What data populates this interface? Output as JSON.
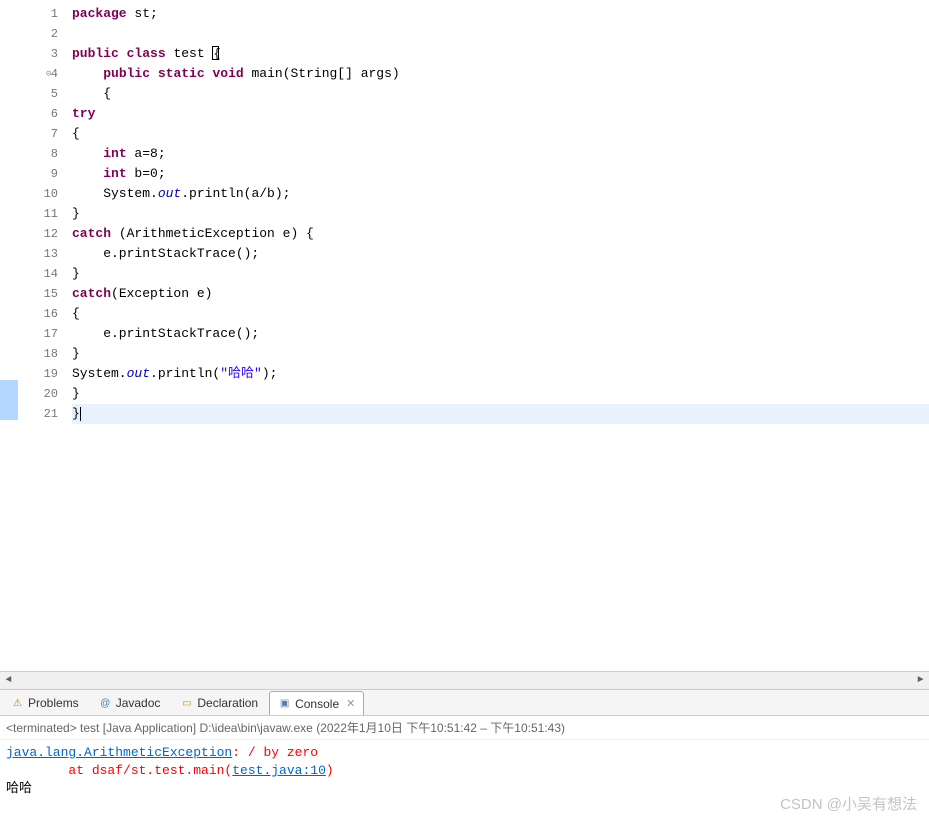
{
  "editor": {
    "lines": [
      {
        "n": "1",
        "strip": "",
        "segs": [
          {
            "t": "kw",
            "v": "package"
          },
          {
            "t": "plain",
            "v": " st;"
          }
        ]
      },
      {
        "n": "2",
        "strip": "",
        "segs": []
      },
      {
        "n": "3",
        "strip": "",
        "segs": [
          {
            "t": "kw",
            "v": "public"
          },
          {
            "t": "plain",
            "v": " "
          },
          {
            "t": "kw",
            "v": "class"
          },
          {
            "t": "plain",
            "v": " test "
          },
          {
            "t": "box",
            "v": "{"
          }
        ]
      },
      {
        "n": "4",
        "marker": "⊝",
        "strip": "",
        "segs": [
          {
            "t": "plain",
            "v": "    "
          },
          {
            "t": "kw",
            "v": "public"
          },
          {
            "t": "plain",
            "v": " "
          },
          {
            "t": "kw",
            "v": "static"
          },
          {
            "t": "plain",
            "v": " "
          },
          {
            "t": "kw",
            "v": "void"
          },
          {
            "t": "plain",
            "v": " main(String[] args)"
          }
        ]
      },
      {
        "n": "5",
        "strip": "",
        "segs": [
          {
            "t": "plain",
            "v": "    {"
          }
        ]
      },
      {
        "n": "6",
        "strip": "",
        "segs": [
          {
            "t": "kw",
            "v": "try"
          }
        ]
      },
      {
        "n": "7",
        "strip": "",
        "segs": [
          {
            "t": "plain",
            "v": "{"
          }
        ]
      },
      {
        "n": "8",
        "strip": "",
        "segs": [
          {
            "t": "plain",
            "v": "    "
          },
          {
            "t": "kw",
            "v": "int"
          },
          {
            "t": "plain",
            "v": " a=8;"
          }
        ]
      },
      {
        "n": "9",
        "strip": "",
        "segs": [
          {
            "t": "plain",
            "v": "    "
          },
          {
            "t": "kw",
            "v": "int"
          },
          {
            "t": "plain",
            "v": " b=0;"
          }
        ]
      },
      {
        "n": "10",
        "strip": "",
        "segs": [
          {
            "t": "plain",
            "v": "    System."
          },
          {
            "t": "field",
            "v": "out"
          },
          {
            "t": "plain",
            "v": ".println(a/b);"
          }
        ]
      },
      {
        "n": "11",
        "strip": "",
        "segs": [
          {
            "t": "plain",
            "v": "}"
          }
        ]
      },
      {
        "n": "12",
        "strip": "",
        "segs": [
          {
            "t": "kw",
            "v": "catch"
          },
          {
            "t": "plain",
            "v": " (ArithmeticException e) {"
          }
        ]
      },
      {
        "n": "13",
        "strip": "",
        "segs": [
          {
            "t": "plain",
            "v": "    e.printStackTrace();"
          }
        ]
      },
      {
        "n": "14",
        "strip": "",
        "segs": [
          {
            "t": "plain",
            "v": "}"
          }
        ]
      },
      {
        "n": "15",
        "strip": "",
        "segs": [
          {
            "t": "kw",
            "v": "catch"
          },
          {
            "t": "plain",
            "v": "(Exception e)"
          }
        ]
      },
      {
        "n": "16",
        "strip": "",
        "segs": [
          {
            "t": "plain",
            "v": "{"
          }
        ]
      },
      {
        "n": "17",
        "strip": "",
        "segs": [
          {
            "t": "plain",
            "v": "    e.printStackTrace();"
          }
        ]
      },
      {
        "n": "18",
        "strip": "",
        "segs": [
          {
            "t": "plain",
            "v": "}"
          }
        ]
      },
      {
        "n": "19",
        "strip": "",
        "segs": [
          {
            "t": "plain",
            "v": "System."
          },
          {
            "t": "field",
            "v": "out"
          },
          {
            "t": "plain",
            "v": ".println("
          },
          {
            "t": "str",
            "v": "\"哈哈\""
          },
          {
            "t": "plain",
            "v": ");"
          }
        ]
      },
      {
        "n": "20",
        "strip": "blue",
        "segs": [
          {
            "t": "plain",
            "v": "}"
          }
        ]
      },
      {
        "n": "21",
        "strip": "blue",
        "hl": true,
        "segs": [
          {
            "t": "plain",
            "v": "}"
          },
          {
            "t": "cursor",
            "v": ""
          }
        ]
      }
    ]
  },
  "tabs": {
    "problems": {
      "label": "Problems",
      "icon": "⚠"
    },
    "javadoc": {
      "label": "Javadoc",
      "icon": "@"
    },
    "declaration": {
      "label": "Declaration",
      "icon": "📋"
    },
    "console": {
      "label": "Console",
      "icon": "▣",
      "close": "✕"
    }
  },
  "console": {
    "header_prefix": "<terminated>",
    "header_main": " test [Java Application] D:\\idea\\bin\\javaw.exe  (2022年1月10日 下午10:51:42 – 下午10:51:43)",
    "line1_link": "java.lang.ArithmeticException",
    "line1_rest": ": / by zero",
    "line2_prefix": "        at dsaf/st.test.main(",
    "line2_link": "test.java:10",
    "line2_suffix": ")",
    "line3": "哈哈"
  },
  "watermark": "CSDN @小吴有想法"
}
